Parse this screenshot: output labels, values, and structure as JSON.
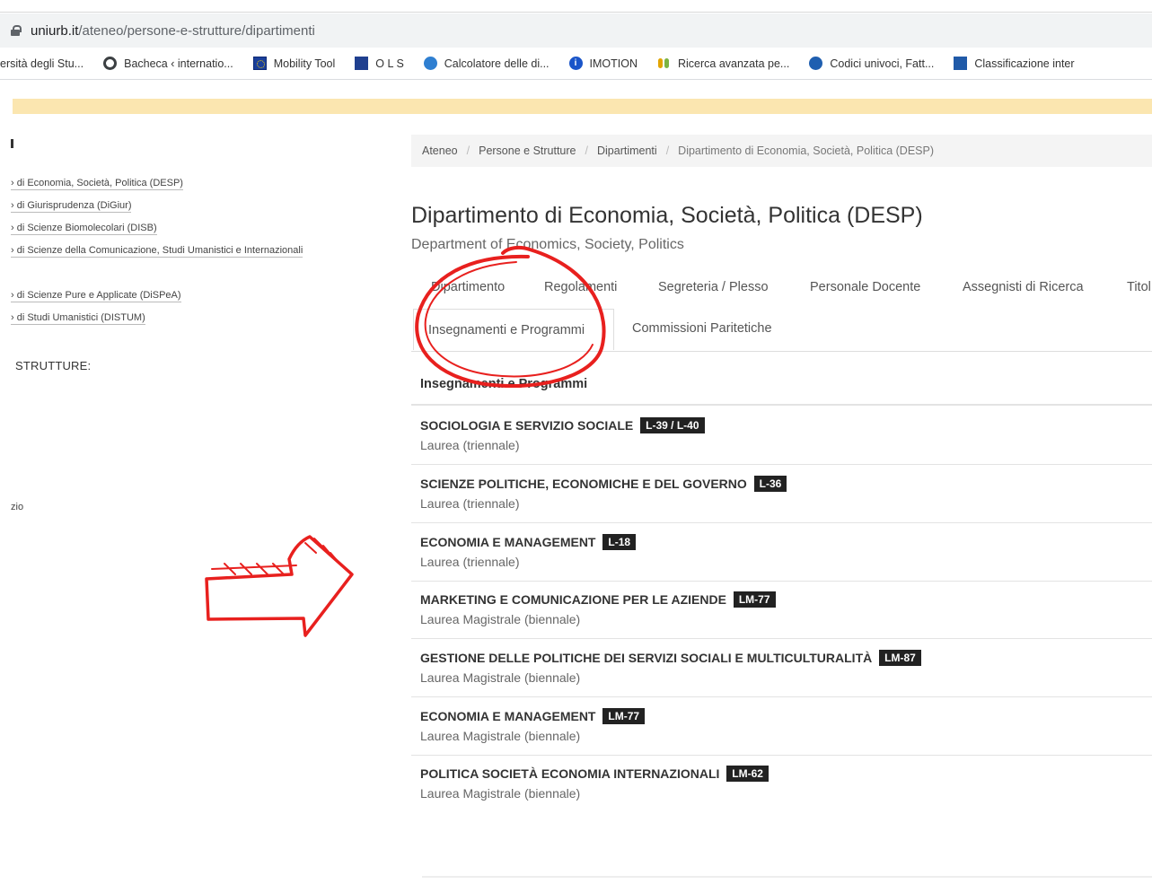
{
  "browser": {
    "url_host": "uniurb.it",
    "url_path": "/ateneo/persone-e-strutture/dipartimenti",
    "bookmarks": [
      {
        "label": "ersità degli Stu...",
        "icon": "none"
      },
      {
        "label": "Bacheca ‹ internatio...",
        "icon": "globe-icon"
      },
      {
        "label": "Mobility Tool",
        "icon": "eu-flag-icon"
      },
      {
        "label": "O L S",
        "icon": "ols-icon"
      },
      {
        "label": "Calcolatore delle di...",
        "icon": "calculator-icon"
      },
      {
        "label": "IMOTION",
        "icon": "imotion-icon"
      },
      {
        "label": "Ricerca avanzata pe...",
        "icon": "people-icon"
      },
      {
        "label": "Codici univoci, Fatt...",
        "icon": "globe-blue-icon"
      },
      {
        "label": "Classificazione inter",
        "icon": "classification-icon"
      }
    ]
  },
  "sidebar": {
    "links": [
      "› di Economia, Società, Politica (DESP)",
      "› di Giurisprudenza (DiGiur)",
      "› di Scienze Biomolecolari (DISB)",
      "› di Scienze della Comunicazione, Studi Umanistici e Internazionali",
      "› di Scienze Pure e Applicate (DiSPeA)",
      "› di Studi Umanistici (DISTUM)"
    ],
    "heading": "STRUTTURE:",
    "fragment": "zio"
  },
  "breadcrumb": {
    "items": [
      "Ateneo",
      "Persone e Strutture",
      "Dipartimenti"
    ],
    "current": "Dipartimento di Economia, Società, Politica (DESP)"
  },
  "page": {
    "title": "Dipartimento di Economia, Società, Politica (DESP)",
    "subtitle": "Department of Economics, Society, Politics"
  },
  "tabs": {
    "row1": [
      "Dipartimento",
      "Regolamenti",
      "Segreteria / Plesso",
      "Personale Docente",
      "Assegnisti di Ricerca",
      "Titol"
    ],
    "active": "Insegnamenti e Programmi",
    "second": "Commissioni Paritetiche"
  },
  "section": {
    "header": "Insegnamenti e Programmi"
  },
  "courses": [
    {
      "name": "SOCIOLOGIA E SERVIZIO SOCIALE",
      "code": "L-39 / L-40",
      "type": "Laurea (triennale)"
    },
    {
      "name": "SCIENZE POLITICHE, ECONOMICHE E DEL GOVERNO",
      "code": "L-36",
      "type": "Laurea (triennale)"
    },
    {
      "name": "ECONOMIA E MANAGEMENT",
      "code": "L-18",
      "type": "Laurea (triennale)"
    },
    {
      "name": "MARKETING E COMUNICAZIONE PER LE AZIENDE",
      "code": "LM-77",
      "type": "Laurea Magistrale (biennale)"
    },
    {
      "name": "GESTIONE DELLE POLITICHE DEI SERVIZI SOCIALI E MULTICULTURALITÀ",
      "code": "LM-87",
      "type": "Laurea Magistrale (biennale)"
    },
    {
      "name": "ECONOMIA E MANAGEMENT",
      "code": "LM-77",
      "type": "Laurea Magistrale (biennale)"
    },
    {
      "name": "POLITICA SOCIETÀ ECONOMIA INTERNAZIONALI",
      "code": "LM-62",
      "type": "Laurea Magistrale (biennale)"
    }
  ],
  "annotations": {
    "color": "#e8201e"
  }
}
